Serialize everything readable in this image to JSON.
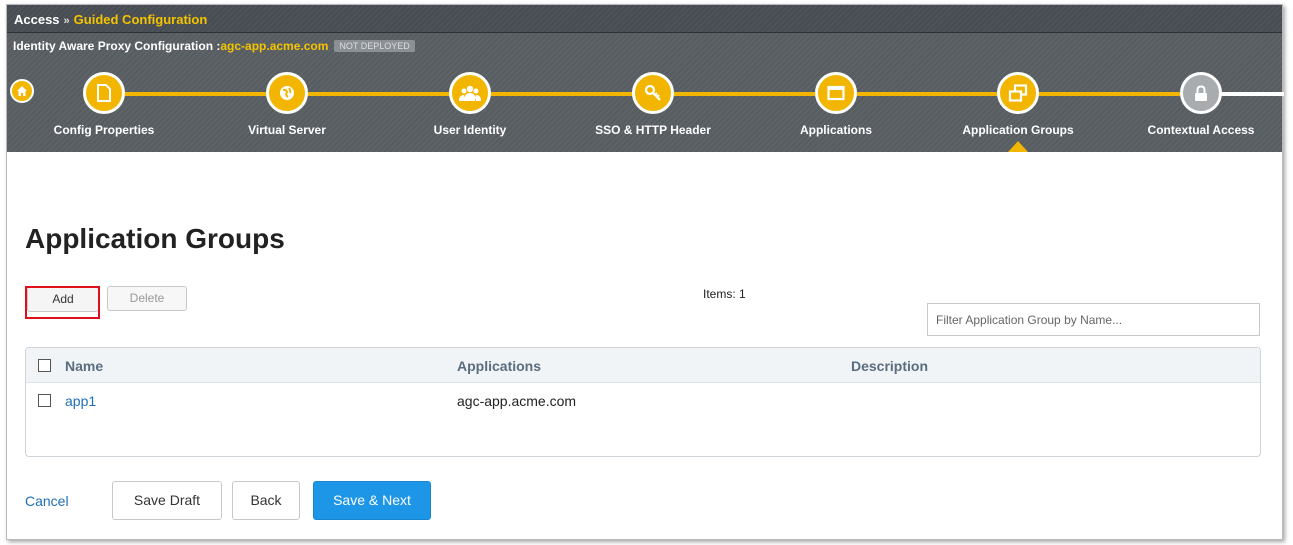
{
  "breadcrumb": {
    "root": "Access",
    "separator": "»",
    "current": "Guided Configuration"
  },
  "wizard": {
    "title_prefix": "Identity Aware Proxy Configuration :",
    "host": "agc-app.acme.com",
    "status_badge": "NOT DEPLOYED",
    "active_step": "Application Groups",
    "steps": [
      {
        "label": "Config Properties",
        "icon": "document-icon",
        "state": "done"
      },
      {
        "label": "Virtual Server",
        "icon": "globe-icon",
        "state": "done"
      },
      {
        "label": "User Identity",
        "icon": "users-icon",
        "state": "done"
      },
      {
        "label": "SSO & HTTP Header",
        "icon": "key-icon",
        "state": "done"
      },
      {
        "label": "Applications",
        "icon": "window-icon",
        "state": "done"
      },
      {
        "label": "Application Groups",
        "icon": "group-windows-icon",
        "state": "active"
      },
      {
        "label": "Contextual Access",
        "icon": "lock-icon",
        "state": "pending"
      }
    ],
    "accent_color": "#f3b600"
  },
  "page": {
    "title": "Application Groups"
  },
  "toolbar": {
    "add_label": "Add",
    "delete_label": "Delete"
  },
  "items_count": "Items: 1",
  "filter": {
    "placeholder": "Filter Application Group by Name...",
    "value": ""
  },
  "table": {
    "columns": [
      "Name",
      "Applications",
      "Description"
    ],
    "rows": [
      {
        "name": "app1",
        "applications": "agc-app.acme.com",
        "description": ""
      }
    ]
  },
  "footer": {
    "cancel_label": "Cancel",
    "save_draft_label": "Save Draft",
    "back_label": "Back",
    "save_next_label": "Save & Next"
  }
}
